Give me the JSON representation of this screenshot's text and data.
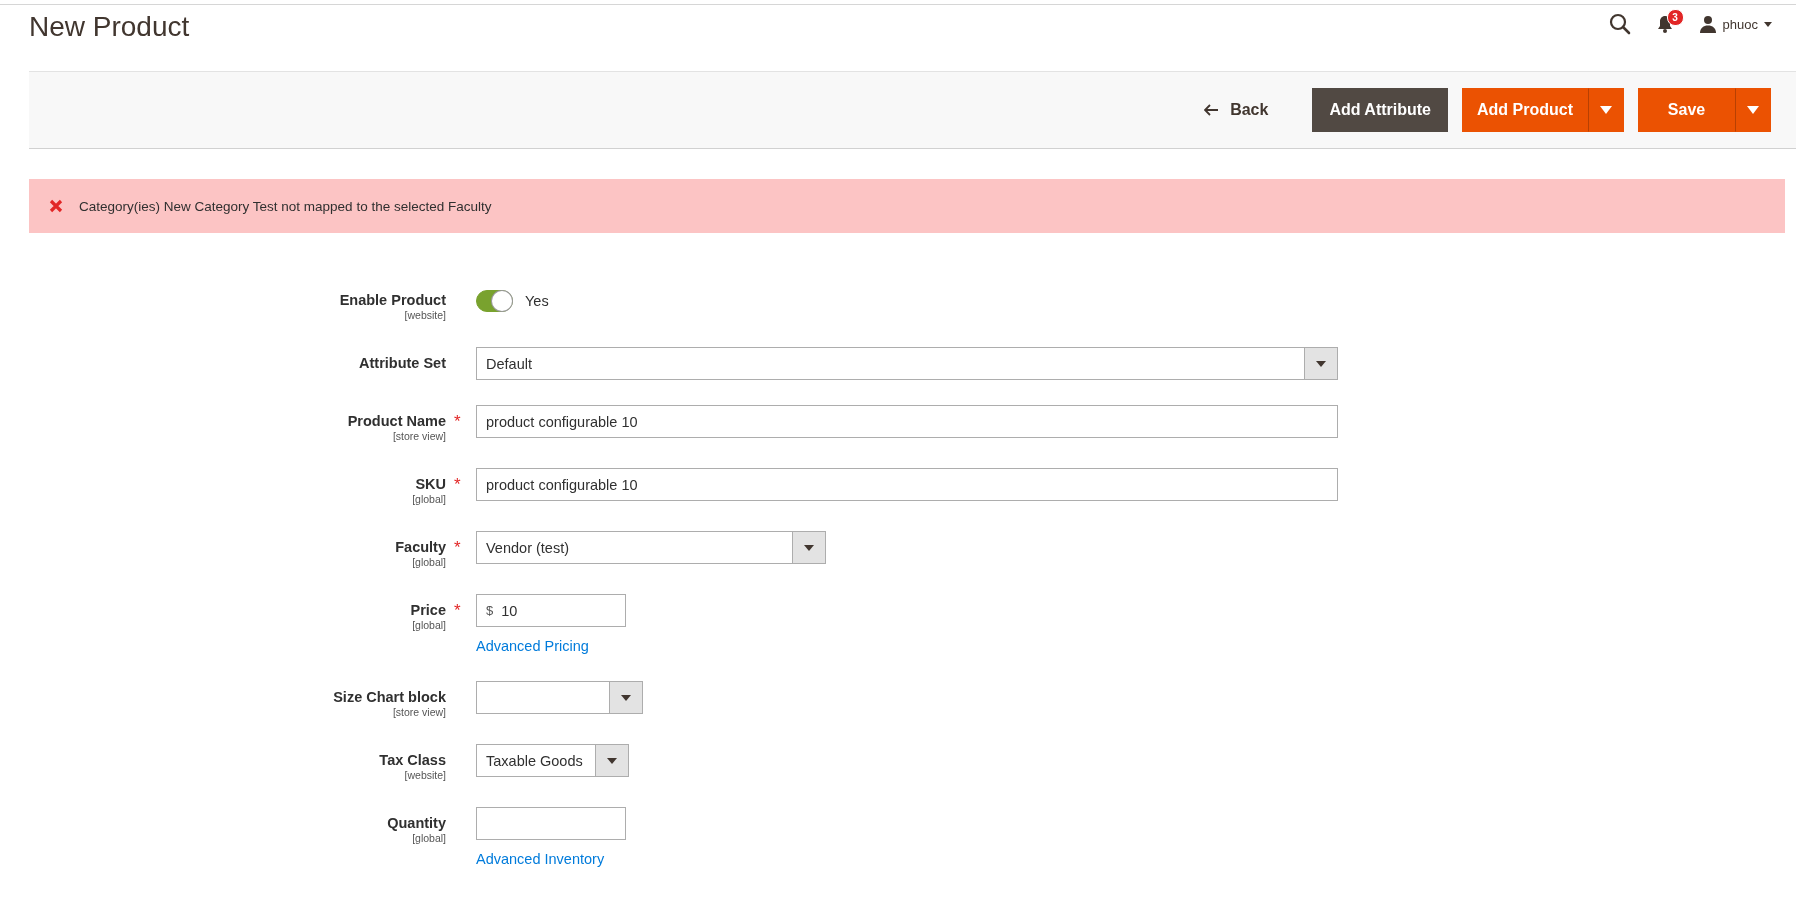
{
  "page_title": "New Product",
  "header": {
    "notifications_count": "3",
    "user_name": "phuoc"
  },
  "actions": [
    {
      "kind": "link",
      "label": "Back"
    },
    {
      "kind": "dark",
      "label": "Add Attribute"
    },
    {
      "kind": "split",
      "label": "Add Product"
    },
    {
      "kind": "split",
      "label": "Save"
    }
  ],
  "message": {
    "text": "Category(ies) New Category Test not mapped to the selected Faculty"
  },
  "fields": [
    {
      "kind": "toggle",
      "label": "Enable Product",
      "scope": "[website]",
      "on": true,
      "value": "Yes"
    },
    {
      "kind": "select",
      "label": "Attribute Set",
      "value": "Default"
    },
    {
      "kind": "text",
      "label": "Product Name",
      "scope": "[store view]",
      "required_mark": "*",
      "value": "product configurable 10"
    },
    {
      "kind": "text",
      "label": "SKU",
      "scope": "[global]",
      "required_mark": "*",
      "value": "product configurable 10"
    },
    {
      "kind": "select",
      "label": "Faculty",
      "scope": "[global]",
      "required_mark": "*",
      "value": "Vendor (test)"
    },
    {
      "kind": "price",
      "label": "Price",
      "scope": "[global]",
      "required_mark": "*",
      "prefix": "$",
      "value": "10",
      "link": "Advanced Pricing"
    },
    {
      "kind": "select",
      "label": "Size Chart block",
      "scope": "[store view]"
    },
    {
      "kind": "select",
      "label": "Tax Class",
      "scope": "[website]",
      "value": "Taxable Goods"
    },
    {
      "kind": "text",
      "label": "Quantity",
      "scope": "[global]",
      "link": "Advanced Inventory"
    }
  ]
}
